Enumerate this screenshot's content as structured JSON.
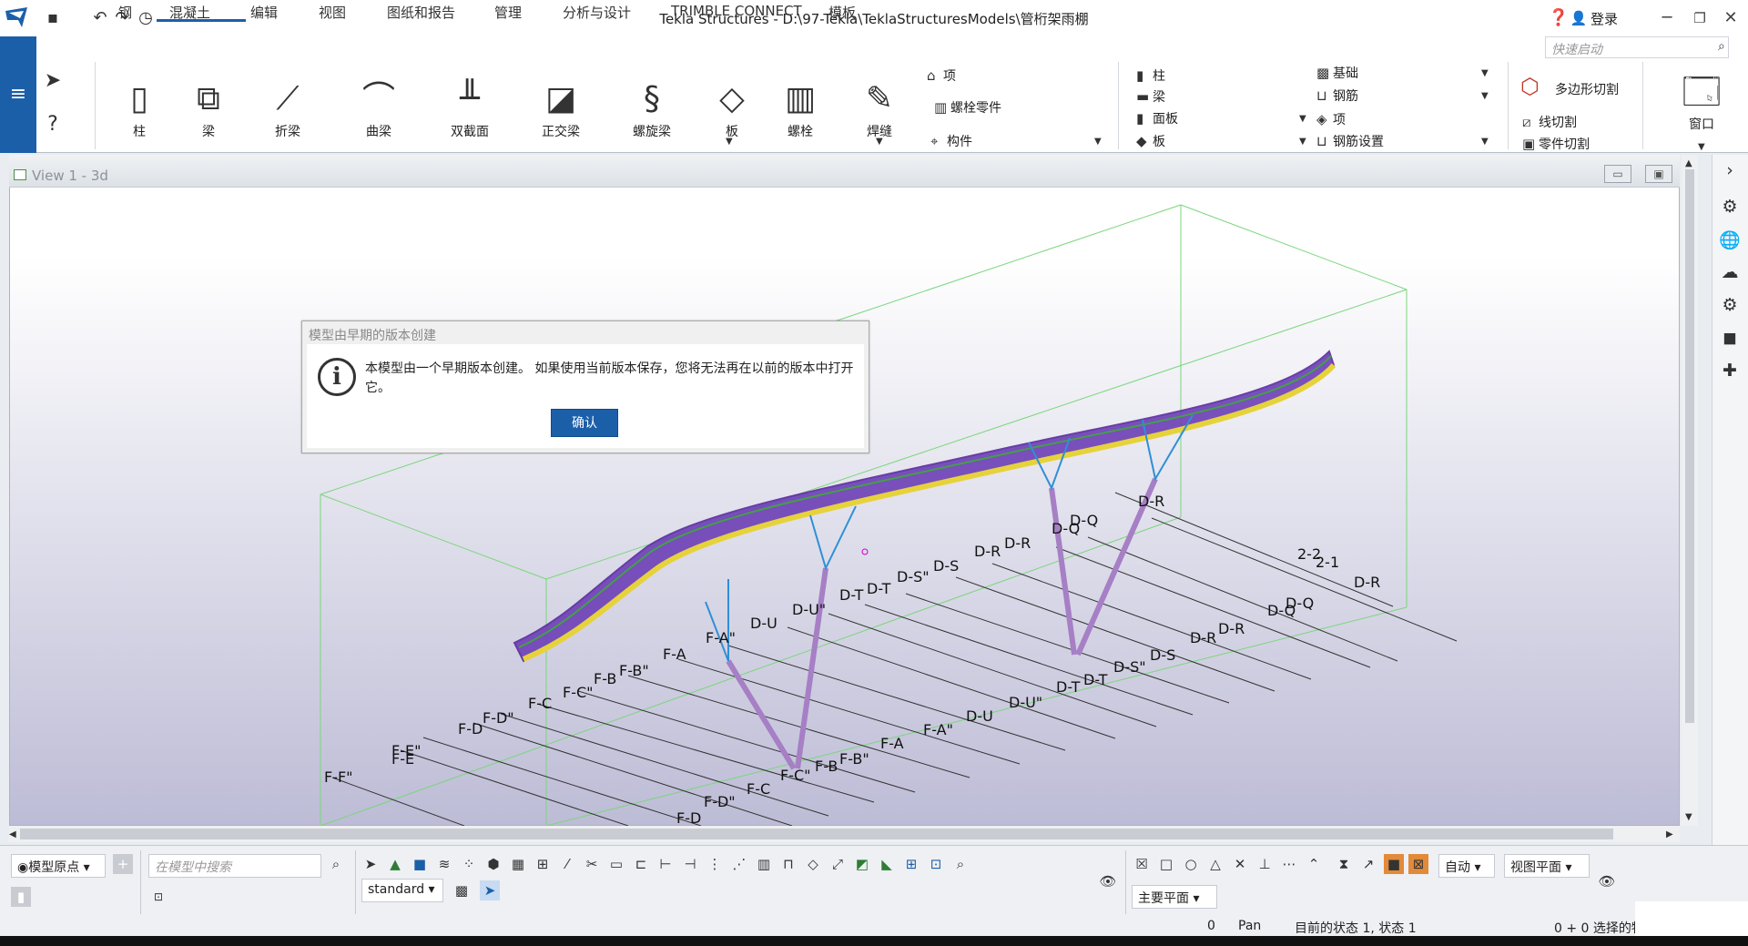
{
  "window": {
    "title": "Tekla Structures - D:\\97-Tekla\\TeklaStructuresModels\\管桁架雨棚",
    "login": "登录"
  },
  "menu": {
    "tabs": [
      "钢",
      "混凝土",
      "编辑",
      "视图",
      "图纸和报告",
      "管理",
      "分析与设计",
      "TRIMBLE CONNECT",
      "模板"
    ],
    "active": "混凝土"
  },
  "quick_launch": {
    "placeholder": "快速启动"
  },
  "ribbon": {
    "tools": [
      "柱",
      "梁",
      "折梁",
      "曲梁",
      "双截面",
      "正交梁",
      "螺旋梁",
      "板",
      "螺栓",
      "焊缝"
    ],
    "group1": [
      "项",
      "螺栓零件",
      "构件"
    ],
    "group2a": [
      "柱",
      "梁",
      "面板",
      "板"
    ],
    "group2b": [
      "基础",
      "钢筋",
      "项",
      "钢筋设置"
    ],
    "group3": [
      "多边形切割",
      "线切割",
      "零件切割"
    ],
    "window_label": "窗口"
  },
  "view": {
    "title": "View 1 - 3d"
  },
  "dialog": {
    "title": "模型由早期的版本创建",
    "message": "本模型由一个早期版本创建。 如果使用当前版本保存，您将无法再在以前的版本中打开它。",
    "ok": "确认"
  },
  "grid_labels": {
    "front": [
      "F-F\"",
      "F-E\"",
      "F-E",
      "F-D",
      "F-D\"",
      "F-C",
      "F-C\"",
      "F-B",
      "F-B\"",
      "F-A",
      "F-A\"",
      "D-U",
      "D-U\"",
      "D-T",
      "D-T",
      "D-S\"",
      "D-S",
      "D-R",
      "D-R",
      "D-Q",
      "D-Q",
      "D-R"
    ],
    "back": [
      "F-D",
      "F-D\"",
      "F-C",
      "F-C\"",
      "F-B",
      "F-B\"",
      "F-A",
      "F-A\"",
      "D-U",
      "D-U\"",
      "D-T",
      "D-T",
      "D-S\"",
      "D-S",
      "D-R",
      "D-R",
      "D-Q",
      "D-Q",
      "D-R",
      "2-2",
      "2-1"
    ]
  },
  "bottom": {
    "origin": "模型原点",
    "search_placeholder": "在模型中搜索",
    "filter": "standard",
    "snap_auto": "自动",
    "snap_plane": "视图平面",
    "work_plane": "主要平面"
  },
  "status": {
    "count": "0",
    "mode": "Pan",
    "state": "目前的状态 1, 状态 1",
    "selection": "0 + 0 选择的物"
  }
}
